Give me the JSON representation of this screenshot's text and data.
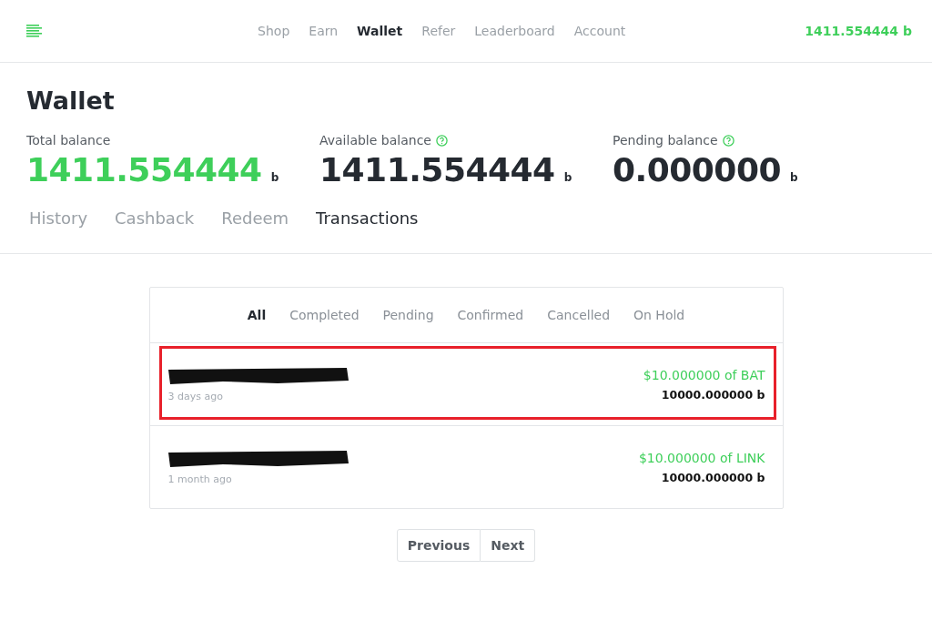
{
  "nav": {
    "items": [
      {
        "label": "Shop",
        "selected": false
      },
      {
        "label": "Earn",
        "selected": false
      },
      {
        "label": "Wallet",
        "selected": true
      },
      {
        "label": "Refer",
        "selected": false
      },
      {
        "label": "Leaderboard",
        "selected": false
      },
      {
        "label": "Account",
        "selected": false
      }
    ],
    "balance": "1411.554444 b"
  },
  "page_title": "Wallet",
  "balances": [
    {
      "label": "Total balance",
      "amount": "1411.554444",
      "unit": "b",
      "accent": true,
      "help": false
    },
    {
      "label": "Available balance",
      "amount": "1411.554444",
      "unit": "b",
      "accent": false,
      "help": true
    },
    {
      "label": "Pending balance",
      "amount": "0.000000",
      "unit": "b",
      "accent": false,
      "help": true
    }
  ],
  "tabs": [
    {
      "label": "History",
      "selected": false
    },
    {
      "label": "Cashback",
      "selected": false
    },
    {
      "label": "Redeem",
      "selected": false
    },
    {
      "label": "Transactions",
      "selected": true
    }
  ],
  "filters": [
    {
      "label": "All",
      "selected": true
    },
    {
      "label": "Completed",
      "selected": false
    },
    {
      "label": "Pending",
      "selected": false
    },
    {
      "label": "Confirmed",
      "selected": false
    },
    {
      "label": "Cancelled",
      "selected": false
    },
    {
      "label": "On Hold",
      "selected": false
    }
  ],
  "transactions": [
    {
      "time": "3 days ago",
      "value": "$10.000000 of BAT",
      "points": "10000.000000 b",
      "highlighted": true
    },
    {
      "time": "1 month ago",
      "value": "$10.000000 of LINK",
      "points": "10000.000000 b",
      "highlighted": false
    }
  ],
  "pagination": [
    "Previous",
    "Next"
  ]
}
